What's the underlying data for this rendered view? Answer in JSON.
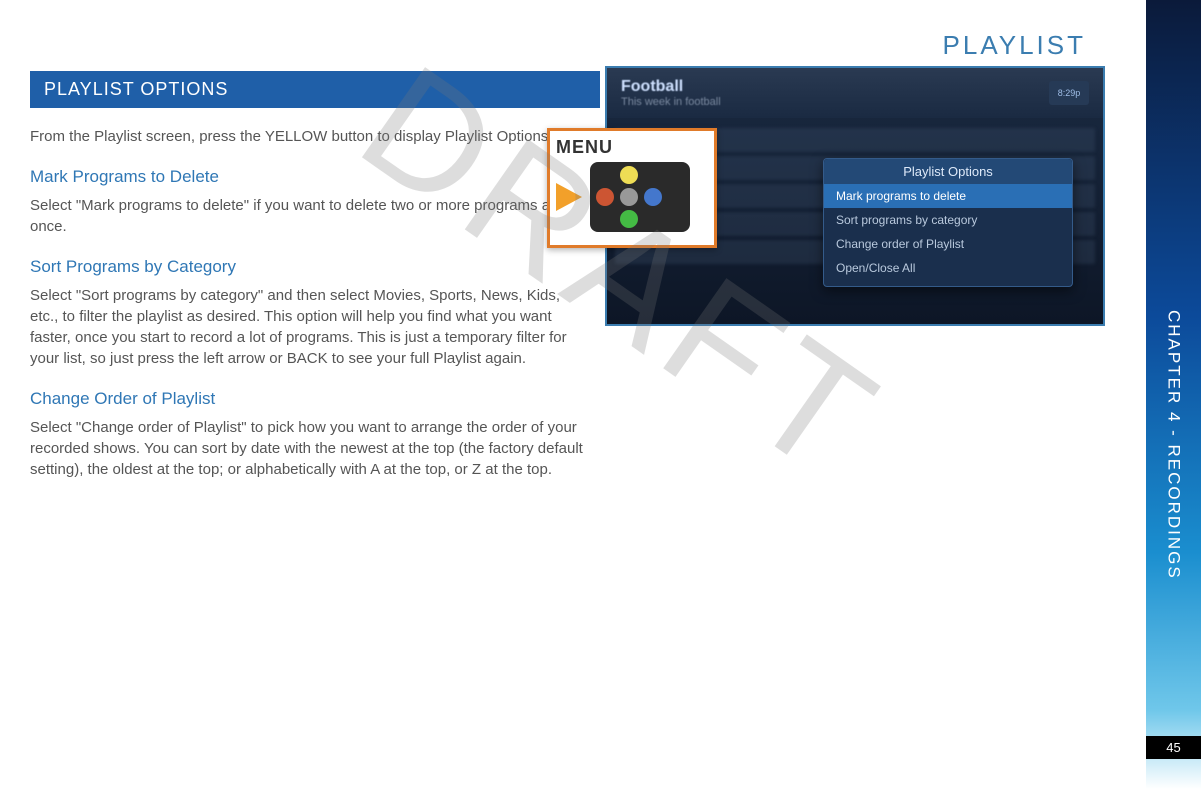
{
  "page": {
    "top_title": "PLAYLIST",
    "section_bar": "PLAYLIST OPTIONS",
    "watermark": "DRAFT",
    "intro": "From the Playlist screen, press the YELLOW button to display Playlist Options.",
    "sections": [
      {
        "heading": "Mark Programs to Delete",
        "body": "Select \"Mark programs to delete\" if you want to delete two or more programs at once."
      },
      {
        "heading": "Sort Programs by Category",
        "body": "Select \"Sort programs by category\" and then select Movies, Sports, News, Kids, etc., to filter the playlist as desired. This option will help you find what you want faster, once you start to record a lot of programs. This is just a temporary filter for your list, so just press the left arrow or BACK to see your full Playlist again."
      },
      {
        "heading": "Change Order of Playlist",
        "body": "Select \"Change order of Playlist\" to pick how you want to arrange the order of your recorded shows. You can sort by date with the newest at the top (the factory default setting), the oldest at the top; or alphabetically with A at the top, or Z at the top."
      }
    ]
  },
  "side": {
    "chapter": "CHAPTER 4 -  RECORDINGS",
    "page_num": "45"
  },
  "tv": {
    "title": "Football",
    "subtitle": "This week in football",
    "badge": "8:29p",
    "popup_title": "Playlist Options",
    "popup_items": [
      "Mark programs to delete",
      "Sort programs by category",
      "Change order of Playlist",
      "Open/Close All"
    ]
  },
  "remote": {
    "label": "MENU"
  }
}
